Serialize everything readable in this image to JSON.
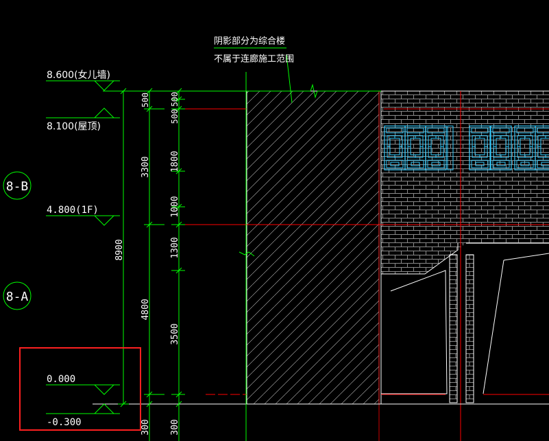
{
  "colors": {
    "background": "#000000",
    "text": "#ffffff",
    "dimension": "#00ff00",
    "axis": "#ff0000",
    "window": "#33ccff",
    "brick": "#8a8a8a",
    "highlight": "#ff2020"
  },
  "annotation": {
    "line1": "阴影部分为综合楼",
    "line2": "不属于连廊施工范围"
  },
  "elevations": {
    "parapet": "8.600(女儿墙)",
    "roof": "8.100(屋顶)",
    "first_floor": "4.800(1F)",
    "ground": "0.000",
    "bottom": "-0.300"
  },
  "grid_axes": {
    "b": "8-B",
    "a": "8-A"
  },
  "dimensions": {
    "left_500": "500",
    "left_3300": "3300",
    "left_4800": "4800",
    "total_8900": "8900",
    "left_300": "300",
    "right_500a": "500",
    "right_500b": "500",
    "right_1800": "1800",
    "right_1000": "1000",
    "right_1300": "1300",
    "right_3500": "3500",
    "right_300": "300"
  }
}
